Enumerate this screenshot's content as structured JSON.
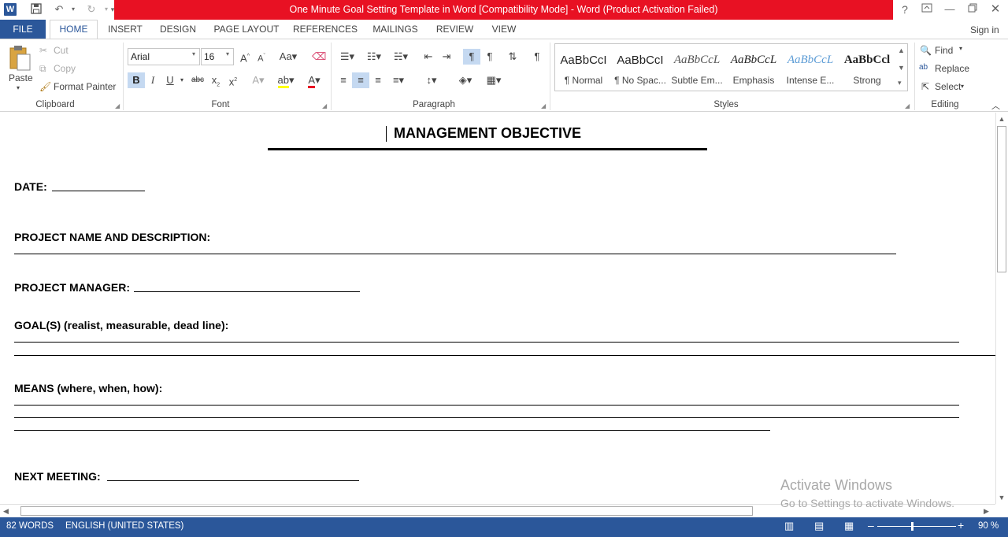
{
  "titlebar": {
    "title": "One Minute Goal Setting Template in Word [Compatibility Mode] -  Word (Product Activation Failed)",
    "help": "?"
  },
  "tabs": [
    "FILE",
    "HOME",
    "INSERT",
    "DESIGN",
    "PAGE LAYOUT",
    "REFERENCES",
    "MAILINGS",
    "REVIEW",
    "VIEW"
  ],
  "signin": "Sign in",
  "clipboard": {
    "paste": "Paste",
    "cut": "Cut",
    "copy": "Copy",
    "format_painter": "Format Painter",
    "label": "Clipboard"
  },
  "font": {
    "family": "Arial",
    "size": "16",
    "label": "Font"
  },
  "paragraph": {
    "label": "Paragraph"
  },
  "styles": {
    "label": "Styles",
    "items": [
      {
        "preview": "AaBbCcI",
        "name": "¶ Normal"
      },
      {
        "preview": "AaBbCcI",
        "name": "¶ No Spac..."
      },
      {
        "preview": "AaBbCcL",
        "name": "Subtle Em..."
      },
      {
        "preview": "AaBbCcL",
        "name": "Emphasis"
      },
      {
        "preview": "AaBbCcL",
        "name": "Intense E..."
      },
      {
        "preview": "AaBbCcl",
        "name": "Strong"
      }
    ]
  },
  "editing": {
    "find": "Find",
    "replace": "Replace",
    "select": "Select",
    "label": "Editing"
  },
  "document": {
    "heading": "MANAGEMENT OBJECTIVE",
    "date": "DATE:",
    "project_name": "PROJECT NAME AND DESCRIPTION:",
    "project_manager": "PROJECT MANAGER:",
    "goals": "GOAL(S) (realist, measurable, dead line):",
    "means": "MEANS (where, when, how):",
    "next_meeting": "NEXT MEETING:"
  },
  "watermark": {
    "line1": "Activate Windows",
    "line2": "Go to Settings to activate Windows."
  },
  "status": {
    "words": "82 WORDS",
    "language": "ENGLISH (UNITED STATES)",
    "zoom": "90 %"
  },
  "colors": {
    "accent": "#2b579a",
    "titlebar_warning": "#e81123"
  }
}
